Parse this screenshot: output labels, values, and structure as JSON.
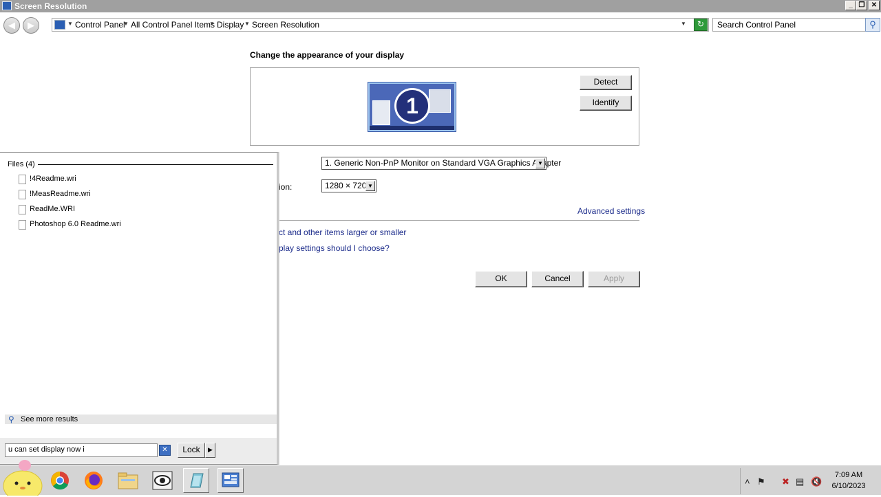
{
  "window": {
    "title": "Screen Resolution",
    "buttons": {
      "minimize": "_",
      "restore": "❐",
      "close": "✕"
    }
  },
  "address": {
    "crumbs": [
      "Control Panel",
      "All Control Panel Items",
      "Display",
      "Screen Resolution"
    ],
    "search_placeholder": "Search Control Panel"
  },
  "main": {
    "heading": "Change the appearance of your display",
    "monitor_number": "1",
    "detect_label": "Detect",
    "identify_label": "Identify",
    "display_value": "1. Generic Non-PnP Monitor on Standard VGA Graphics Adapter",
    "resolution_label_partial": "ion:",
    "resolution_value": "1280 × 720",
    "advanced_settings": "Advanced settings",
    "link_larger_partial": "ct and other items larger or smaller",
    "link_choose_partial": "play settings should I choose?",
    "ok_label": "OK",
    "cancel_label": "Cancel",
    "apply_label": "Apply"
  },
  "start_menu": {
    "files_header": "Files (4)",
    "files": [
      "!4Readme.wri",
      "!MeasReadme.wri",
      "ReadMe.WRI",
      "Photoshop 6.0 Readme.wri"
    ],
    "see_more": "See more results",
    "search_value": "u can set display now i",
    "lock_label": "Lock"
  },
  "taskbar": {
    "time": "7:09 AM",
    "date": "6/10/2023",
    "apps": [
      "chrome-icon",
      "firefox-icon",
      "file-explorer-icon",
      "eye-app-icon",
      "notepad-icon",
      "control-panel-icon"
    ]
  },
  "colors": {
    "titlebar": "#a0a0a0",
    "link": "#1a2a8a",
    "monitor_blue": "#4b68b8"
  }
}
